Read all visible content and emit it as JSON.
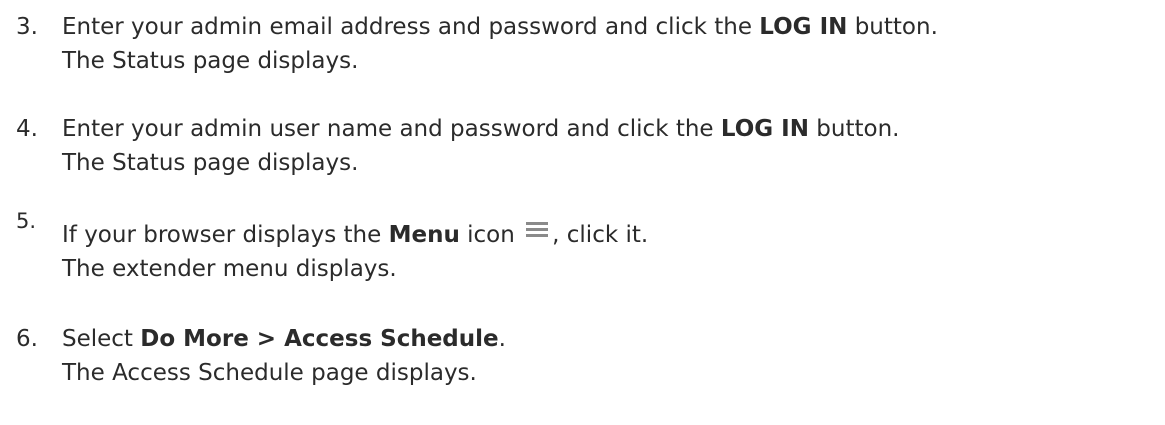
{
  "steps": [
    {
      "number": "3.",
      "line1_pre": "Enter your admin email address and password and click the ",
      "line1_bold": "LOG IN",
      "line1_post": " button.",
      "line2": "The Status page displays."
    },
    {
      "number": "4.",
      "line1_pre": "Enter your admin user name and password and click the ",
      "line1_bold": "LOG IN",
      "line1_post": " button.",
      "line2": "The Status page displays."
    },
    {
      "number": "5.",
      "line1_pre": "If your browser displays the ",
      "line1_bold": "Menu",
      "line1_mid": " icon ",
      "icon": "menu-icon",
      "line1_post": ", click it.",
      "line2": "The extender menu displays."
    },
    {
      "number": "6.",
      "line1_pre": "Select ",
      "line1_bold": "Do More > Access Schedule",
      "line1_post": ".",
      "line2": "The Access Schedule page displays."
    }
  ]
}
